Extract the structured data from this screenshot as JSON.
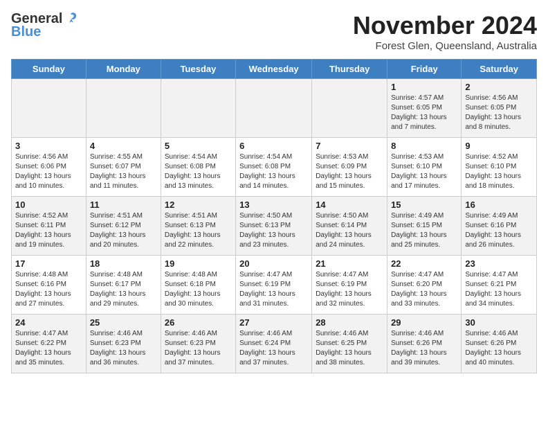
{
  "header": {
    "logo_general": "General",
    "logo_blue": "Blue",
    "month_year": "November 2024",
    "location": "Forest Glen, Queensland, Australia"
  },
  "days_of_week": [
    "Sunday",
    "Monday",
    "Tuesday",
    "Wednesday",
    "Thursday",
    "Friday",
    "Saturday"
  ],
  "weeks": [
    [
      {
        "day": "",
        "content": ""
      },
      {
        "day": "",
        "content": ""
      },
      {
        "day": "",
        "content": ""
      },
      {
        "day": "",
        "content": ""
      },
      {
        "day": "",
        "content": ""
      },
      {
        "day": "1",
        "content": "Sunrise: 4:57 AM\nSunset: 6:05 PM\nDaylight: 13 hours and 7 minutes."
      },
      {
        "day": "2",
        "content": "Sunrise: 4:56 AM\nSunset: 6:05 PM\nDaylight: 13 hours and 8 minutes."
      }
    ],
    [
      {
        "day": "3",
        "content": "Sunrise: 4:56 AM\nSunset: 6:06 PM\nDaylight: 13 hours and 10 minutes."
      },
      {
        "day": "4",
        "content": "Sunrise: 4:55 AM\nSunset: 6:07 PM\nDaylight: 13 hours and 11 minutes."
      },
      {
        "day": "5",
        "content": "Sunrise: 4:54 AM\nSunset: 6:08 PM\nDaylight: 13 hours and 13 minutes."
      },
      {
        "day": "6",
        "content": "Sunrise: 4:54 AM\nSunset: 6:08 PM\nDaylight: 13 hours and 14 minutes."
      },
      {
        "day": "7",
        "content": "Sunrise: 4:53 AM\nSunset: 6:09 PM\nDaylight: 13 hours and 15 minutes."
      },
      {
        "day": "8",
        "content": "Sunrise: 4:53 AM\nSunset: 6:10 PM\nDaylight: 13 hours and 17 minutes."
      },
      {
        "day": "9",
        "content": "Sunrise: 4:52 AM\nSunset: 6:10 PM\nDaylight: 13 hours and 18 minutes."
      }
    ],
    [
      {
        "day": "10",
        "content": "Sunrise: 4:52 AM\nSunset: 6:11 PM\nDaylight: 13 hours and 19 minutes."
      },
      {
        "day": "11",
        "content": "Sunrise: 4:51 AM\nSunset: 6:12 PM\nDaylight: 13 hours and 20 minutes."
      },
      {
        "day": "12",
        "content": "Sunrise: 4:51 AM\nSunset: 6:13 PM\nDaylight: 13 hours and 22 minutes."
      },
      {
        "day": "13",
        "content": "Sunrise: 4:50 AM\nSunset: 6:13 PM\nDaylight: 13 hours and 23 minutes."
      },
      {
        "day": "14",
        "content": "Sunrise: 4:50 AM\nSunset: 6:14 PM\nDaylight: 13 hours and 24 minutes."
      },
      {
        "day": "15",
        "content": "Sunrise: 4:49 AM\nSunset: 6:15 PM\nDaylight: 13 hours and 25 minutes."
      },
      {
        "day": "16",
        "content": "Sunrise: 4:49 AM\nSunset: 6:16 PM\nDaylight: 13 hours and 26 minutes."
      }
    ],
    [
      {
        "day": "17",
        "content": "Sunrise: 4:48 AM\nSunset: 6:16 PM\nDaylight: 13 hours and 27 minutes."
      },
      {
        "day": "18",
        "content": "Sunrise: 4:48 AM\nSunset: 6:17 PM\nDaylight: 13 hours and 29 minutes."
      },
      {
        "day": "19",
        "content": "Sunrise: 4:48 AM\nSunset: 6:18 PM\nDaylight: 13 hours and 30 minutes."
      },
      {
        "day": "20",
        "content": "Sunrise: 4:47 AM\nSunset: 6:19 PM\nDaylight: 13 hours and 31 minutes."
      },
      {
        "day": "21",
        "content": "Sunrise: 4:47 AM\nSunset: 6:19 PM\nDaylight: 13 hours and 32 minutes."
      },
      {
        "day": "22",
        "content": "Sunrise: 4:47 AM\nSunset: 6:20 PM\nDaylight: 13 hours and 33 minutes."
      },
      {
        "day": "23",
        "content": "Sunrise: 4:47 AM\nSunset: 6:21 PM\nDaylight: 13 hours and 34 minutes."
      }
    ],
    [
      {
        "day": "24",
        "content": "Sunrise: 4:47 AM\nSunset: 6:22 PM\nDaylight: 13 hours and 35 minutes."
      },
      {
        "day": "25",
        "content": "Sunrise: 4:46 AM\nSunset: 6:23 PM\nDaylight: 13 hours and 36 minutes."
      },
      {
        "day": "26",
        "content": "Sunrise: 4:46 AM\nSunset: 6:23 PM\nDaylight: 13 hours and 37 minutes."
      },
      {
        "day": "27",
        "content": "Sunrise: 4:46 AM\nSunset: 6:24 PM\nDaylight: 13 hours and 37 minutes."
      },
      {
        "day": "28",
        "content": "Sunrise: 4:46 AM\nSunset: 6:25 PM\nDaylight: 13 hours and 38 minutes."
      },
      {
        "day": "29",
        "content": "Sunrise: 4:46 AM\nSunset: 6:26 PM\nDaylight: 13 hours and 39 minutes."
      },
      {
        "day": "30",
        "content": "Sunrise: 4:46 AM\nSunset: 6:26 PM\nDaylight: 13 hours and 40 minutes."
      }
    ]
  ]
}
